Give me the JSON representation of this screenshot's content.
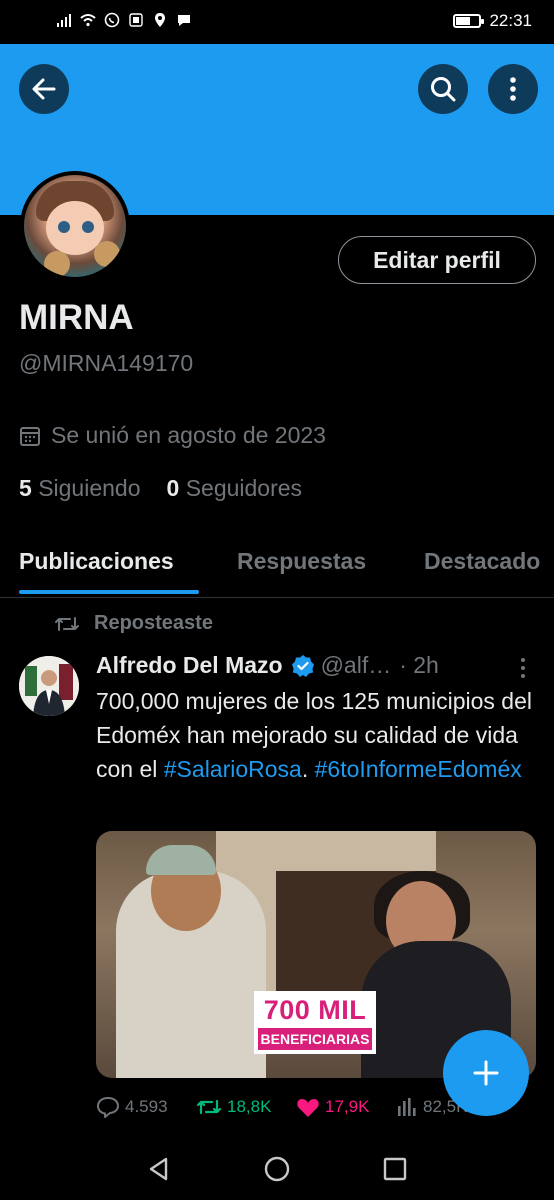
{
  "status_bar": {
    "time": "22:31"
  },
  "header": {
    "back_icon": "arrow-left-icon",
    "search_icon": "search-icon",
    "more_icon": "more-vertical-icon",
    "banner_color": "#1d9bf0"
  },
  "profile": {
    "edit_button": "Editar perfil",
    "name": "MIRNA",
    "handle": "@MIRNA149170",
    "joined": "Se unió en agosto de 2023",
    "following_count": "5",
    "following_label": "Siguiendo",
    "followers_count": "0",
    "followers_label": "Seguidores"
  },
  "tabs": [
    {
      "label": "Publicaciones",
      "active": true
    },
    {
      "label": "Respuestas",
      "active": false
    },
    {
      "label": "Destacado",
      "active": false
    }
  ],
  "post": {
    "repost_label": "Reposteaste",
    "author": "Alfredo Del Mazo",
    "handle": "@alf…",
    "time": "· 2h",
    "text_plain": "700,000 mujeres de los 125 municipios del Edoméx han mejorado su calidad de vida con el",
    "hashtag1": "#SalarioRosa",
    "separator": ".",
    "hashtag2": "#6toInformeEdoméx",
    "media_badge_line1": "700 MIL",
    "media_badge_line2": "BENEFICIARIAS",
    "replies": "4.593",
    "reposts": "18,8K",
    "likes": "17,9K",
    "views": "82,5K"
  },
  "fab_icon": "plus-icon",
  "nav": {
    "back": "nav-back-icon",
    "home": "nav-home-icon",
    "recents": "nav-recents-icon"
  },
  "colors": {
    "accent": "#1d9bf0",
    "repost": "#00ba7c",
    "like": "#f91880",
    "muted": "#71767b"
  }
}
